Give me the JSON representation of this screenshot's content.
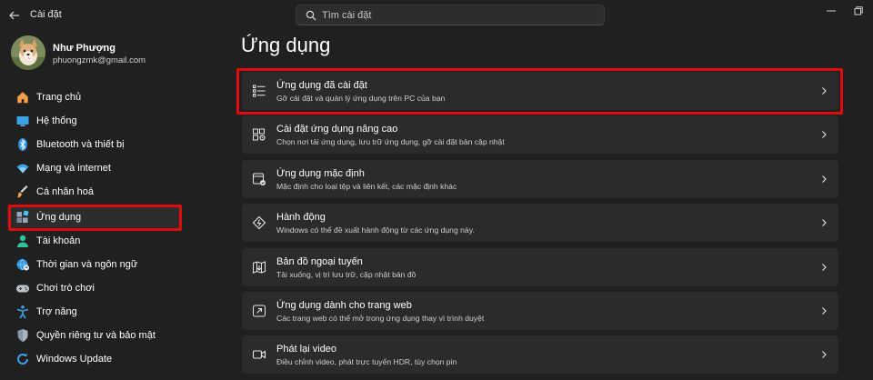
{
  "window": {
    "title": "Cài đặt"
  },
  "search": {
    "placeholder": "Tìm cài đặt"
  },
  "profile": {
    "name": "Như Phượng",
    "email": "phuongzmk@gmail.com"
  },
  "sidebar": {
    "items": [
      {
        "label": "Trang chủ",
        "icon": "home-icon",
        "active": false
      },
      {
        "label": "Hệ thống",
        "icon": "system-icon",
        "active": false
      },
      {
        "label": "Bluetooth và thiết bị",
        "icon": "bluetooth-icon",
        "active": false
      },
      {
        "label": "Mạng và internet",
        "icon": "wifi-icon",
        "active": false
      },
      {
        "label": "Cá nhân hoá",
        "icon": "brush-icon",
        "active": false
      },
      {
        "label": "Ứng dụng",
        "icon": "apps-icon",
        "active": true
      },
      {
        "label": "Tài khoản",
        "icon": "account-icon",
        "active": false
      },
      {
        "label": "Thời gian và ngôn ngữ",
        "icon": "globe-clock-icon",
        "active": false
      },
      {
        "label": "Chơi trò chơi",
        "icon": "gamepad-icon",
        "active": false
      },
      {
        "label": "Trợ năng",
        "icon": "accessibility-icon",
        "active": false
      },
      {
        "label": "Quyền riêng tư và bảo mật",
        "icon": "shield-icon",
        "active": false
      },
      {
        "label": "Windows Update",
        "icon": "update-icon",
        "active": false
      }
    ]
  },
  "main": {
    "title": "Ứng dụng",
    "rows": [
      {
        "title": "Ứng dụng đã cài đặt",
        "desc": "Gỡ cài đặt và quản lý ứng dụng trên PC của bạn",
        "icon": "installed-apps-icon"
      },
      {
        "title": "Cài đặt ứng dụng nâng cao",
        "desc": "Chọn nơi tải ứng dụng, lưu trữ ứng dụng, gỡ cài đặt bản cập nhật",
        "icon": "advanced-apps-icon"
      },
      {
        "title": "Ứng dụng mặc định",
        "desc": "Mặc định cho loại tệp và liên kết, các mặc định khác",
        "icon": "default-apps-icon"
      },
      {
        "title": "Hành động",
        "desc": "Windows có thể đề xuất hành động từ các ứng dụng này.",
        "icon": "actions-icon"
      },
      {
        "title": "Bản đồ ngoại tuyến",
        "desc": "Tải xuống, vị trí lưu trữ, cập nhật bản đồ",
        "icon": "offline-maps-icon"
      },
      {
        "title": "Ứng dụng dành cho trang web",
        "desc": "Các trang web có thể mở trong ứng dụng thay vì trình duyệt",
        "icon": "apps-for-websites-icon"
      },
      {
        "title": "Phát lại video",
        "desc": "Điều chỉnh video, phát trực tuyến HDR, tùy chọn pin",
        "icon": "video-playback-icon"
      }
    ]
  },
  "colors": {
    "background": "#202020",
    "card": "#2b2b2b",
    "highlight": "#e00b0b",
    "accent": "#4cc2ff"
  }
}
